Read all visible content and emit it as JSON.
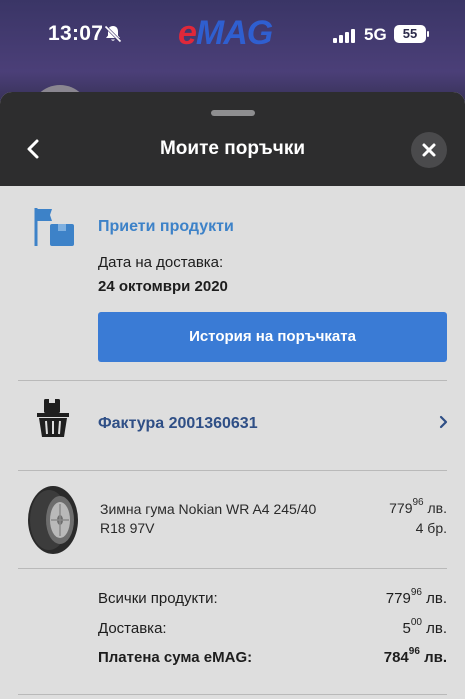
{
  "status_bar": {
    "time": "13:07",
    "brand_e": "e",
    "brand_rest": "MAG",
    "network": "5G",
    "battery": "55"
  },
  "sheet": {
    "title": "Моите поръчки"
  },
  "order_status": {
    "title": "Приети продукти",
    "delivery_label": "Дата на доставка:",
    "delivery_date": "24 октомври 2020",
    "history_button": "История на поръчката"
  },
  "invoice": {
    "label": "Фактура 2001360631"
  },
  "product": {
    "name": "Зимна гума Nokian WR A4 245/40 R18 97V",
    "price_main": "779",
    "price_cents": "96",
    "price_currency": "лв.",
    "quantity": "4 бр."
  },
  "totals": {
    "products_label": "Всички продукти:",
    "products_main": "779",
    "products_cents": "96",
    "products_currency": "лв.",
    "delivery_label": "Доставка:",
    "delivery_main": "5",
    "delivery_cents": "00",
    "delivery_currency": "лв.",
    "paid_label": "Платена сума eMAG:",
    "paid_main": "784",
    "paid_cents": "96",
    "paid_currency": "лв."
  },
  "colors": {
    "accent_blue": "#3a7bd5",
    "status_title": "#3d82c8",
    "invoice_link": "#2f4f86",
    "header_dark": "#2d2d2e",
    "sheet_bg": "#dedede"
  },
  "icons": {
    "bell": "bell-slash-icon",
    "back": "chevron-left-icon",
    "close": "close-icon",
    "status": "flag-box-icon",
    "invoice": "basket-icon",
    "chevron": "chevron-right-icon",
    "product": "tire-image"
  }
}
